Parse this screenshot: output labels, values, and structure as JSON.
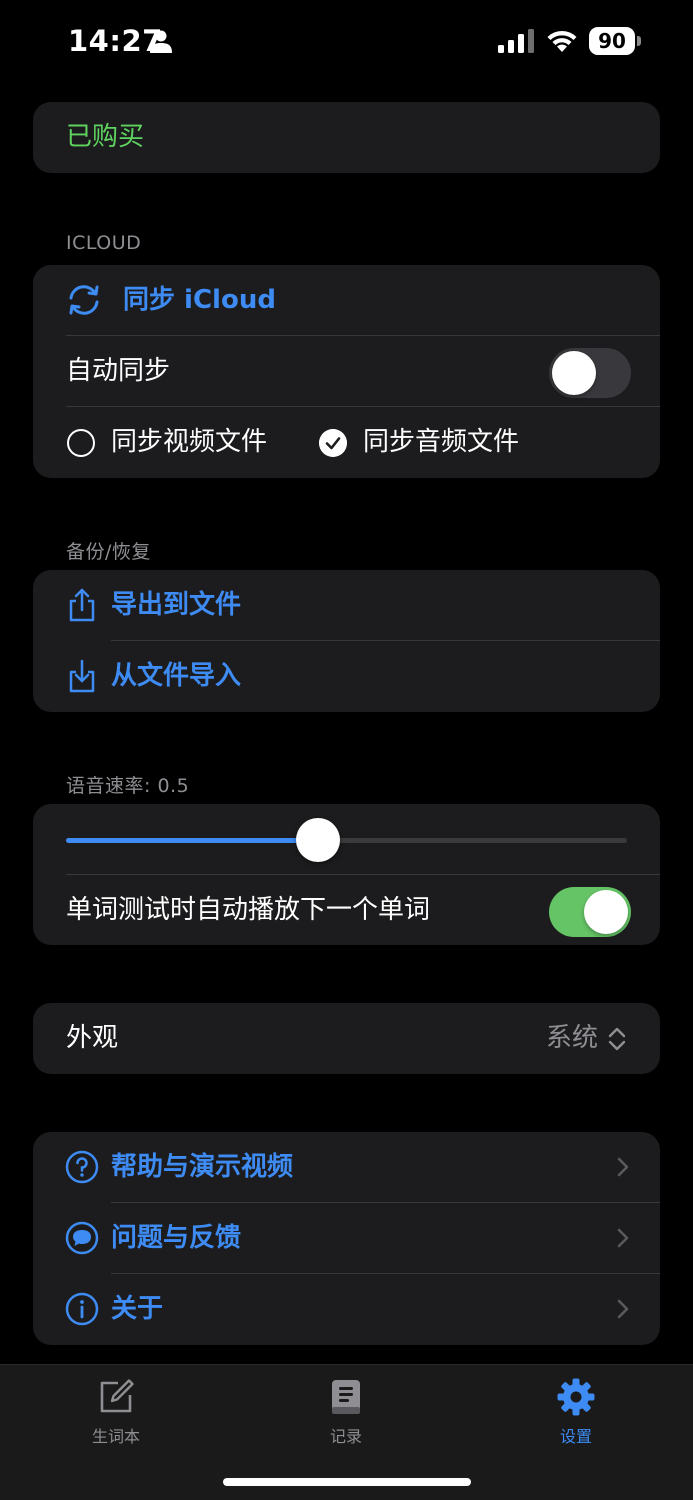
{
  "status_bar": {
    "time": "14:27",
    "battery": "90"
  },
  "purchase": {
    "label": "已购买",
    "color": "#5fd35f"
  },
  "icloud": {
    "header": "ICLOUD",
    "sync_button": "同步 iCloud",
    "auto_sync_label": "自动同步",
    "auto_sync_on": false,
    "sync_video_label": "同步视频文件",
    "sync_video_checked": false,
    "sync_audio_label": "同步音频文件",
    "sync_audio_checked": true
  },
  "backup": {
    "header": "备份/恢复",
    "export_label": "导出到文件",
    "import_label": "从文件导入"
  },
  "speech": {
    "header": "语音速率: 0.5",
    "rate": 0.5,
    "slider_fraction": 0.45,
    "auto_play_label": "单词测试时自动播放下一个单词",
    "auto_play_on": true
  },
  "appearance": {
    "label": "外观",
    "value": "系统"
  },
  "help": {
    "items": [
      {
        "label": "帮助与演示视频",
        "icon": "question-circle-icon"
      },
      {
        "label": "问题与反馈",
        "icon": "chat-bubble-icon"
      },
      {
        "label": "关于",
        "icon": "info-circle-icon"
      }
    ]
  },
  "tab_bar": {
    "items": [
      {
        "label": "生词本",
        "icon": "square-pencil-icon",
        "active": false
      },
      {
        "label": "记录",
        "icon": "book-icon",
        "active": false
      },
      {
        "label": "设置",
        "icon": "gear-icon",
        "active": true
      }
    ]
  },
  "colors": {
    "accent": "#3d8bf3",
    "toggle_on": "#65c466",
    "card_bg": "#1c1c1e"
  }
}
